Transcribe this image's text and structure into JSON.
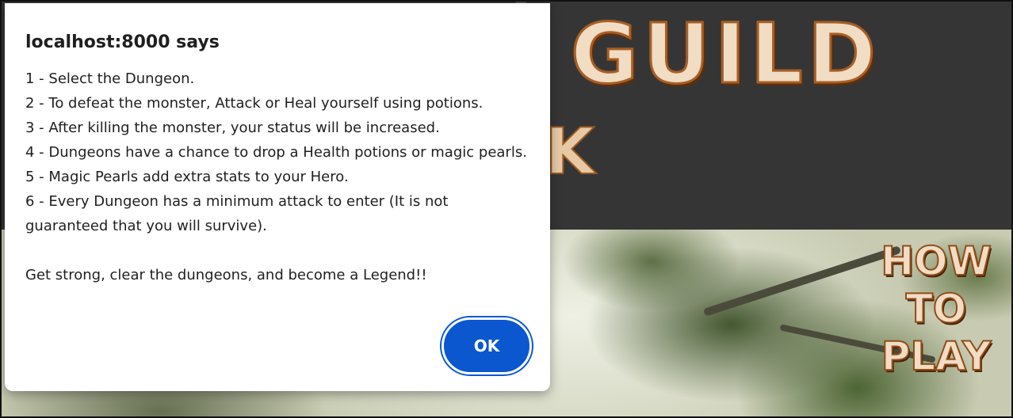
{
  "game": {
    "title": "GUILD",
    "side_glyph": "K",
    "how_to_play": [
      "HOW",
      "TO",
      "PLAY"
    ]
  },
  "dialog": {
    "origin": "localhost:8000 says",
    "lines": [
      "1 - Select the Dungeon.",
      "2 - To defeat the monster, Attack or Heal yourself using potions.",
      "3 - After killing the monster, your status will be increased.",
      "4 - Dungeons have a chance to drop a Health potions or magic pearls.",
      "5 - Magic Pearls add extra stats to your Hero.",
      "6 - Every Dungeon has a minimum attack to enter (It is not guaranteed that you will survive)."
    ],
    "closing": "Get strong, clear the dungeons, and become a Legend!!",
    "ok_label": "OK"
  },
  "colors": {
    "ok_button": "#0b57d0",
    "header_bg": "#353535",
    "title_fill": "#f1dcc4",
    "title_outline": "#a85e22"
  }
}
